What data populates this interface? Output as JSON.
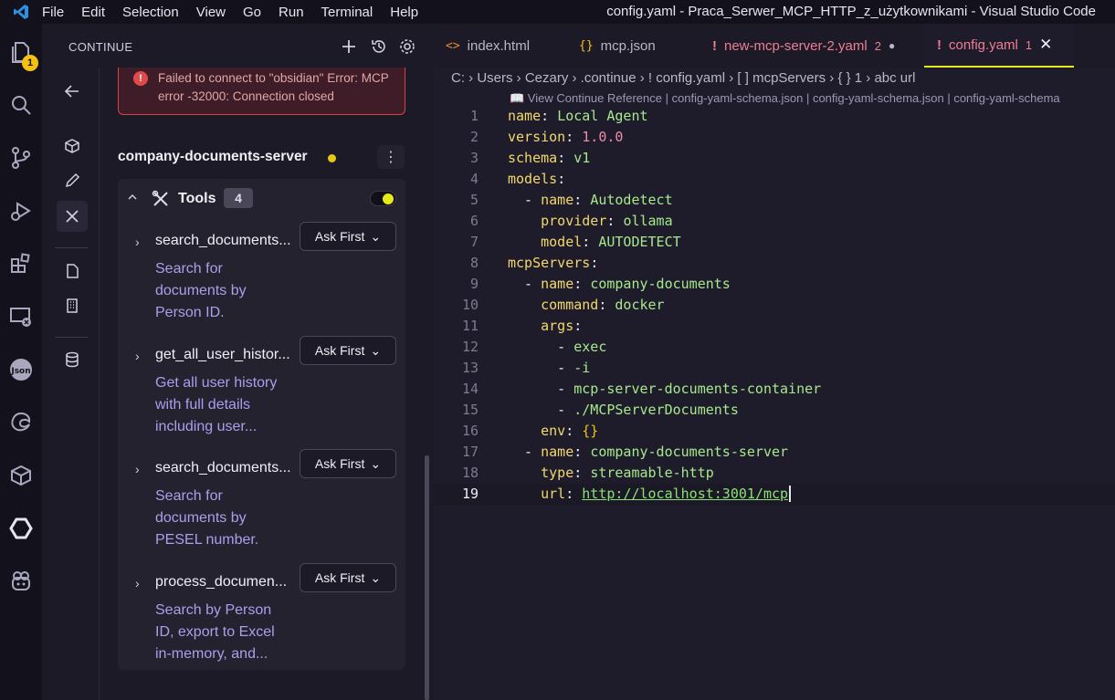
{
  "titlebar": {
    "menu": [
      "File",
      "Edit",
      "Selection",
      "View",
      "Go",
      "Run",
      "Terminal",
      "Help"
    ],
    "title": "config.yaml - Praca_Serwer_MCP_HTTP_z_użytkownikami - Visual Studio Code"
  },
  "activity": {
    "badge": "1"
  },
  "panel": {
    "title": "CONTINUE",
    "error": {
      "text": "Failed to connect to \"obsidian\" Error: MCP error -32000: Connection closed"
    },
    "server": {
      "name": "company-documents-server"
    },
    "tools": {
      "label": "Tools",
      "count": "4",
      "items": [
        {
          "name": "search_documents...",
          "desc": "Search for documents by Person ID.",
          "ask": "Ask First"
        },
        {
          "name": "get_all_user_histor...",
          "desc": "Get all user history with full details including user...",
          "ask": "Ask First"
        },
        {
          "name": "search_documents...",
          "desc": "Search for documents by PESEL number.",
          "ask": "Ask First"
        },
        {
          "name": "process_documen...",
          "desc": "Search by Person ID, export to Excel in-memory, and...",
          "ask": "Ask First"
        }
      ]
    }
  },
  "tabs": [
    {
      "label": "index.html",
      "icon": "<>"
    },
    {
      "label": "mcp.json",
      "icon": "{}"
    },
    {
      "label": "new-mcp-server-2.yaml",
      "badge": "2",
      "icon": "!"
    },
    {
      "label": "config.yaml",
      "badge": "1",
      "icon": "!"
    }
  ],
  "breadcrumb": {
    "text": "C: › Users › Cezary › .continue › ! config.yaml › [ ] mcpServers › { } 1 › abc url"
  },
  "schema_ref": "📖 View Continue Reference | config-yaml-schema.json | config-yaml-schema.json | config-yaml-schema",
  "code": [
    {
      "n": "1",
      "k": "name",
      "v": "Local Agent",
      "vc": "v",
      "ind": ""
    },
    {
      "n": "2",
      "k": "version",
      "v": "1.0.0",
      "vc": "n",
      "ind": ""
    },
    {
      "n": "3",
      "k": "schema",
      "v": "v1",
      "vc": "v",
      "ind": ""
    },
    {
      "n": "4",
      "k": "models",
      "v": "",
      "vc": "v",
      "ind": ""
    },
    {
      "n": "5",
      "k": "name",
      "v": "Autodetect",
      "vc": "v",
      "ind": "  - "
    },
    {
      "n": "6",
      "k": "provider",
      "v": "ollama",
      "vc": "v",
      "ind": "    "
    },
    {
      "n": "7",
      "k": "model",
      "v": "AUTODETECT",
      "vc": "v",
      "ind": "    "
    },
    {
      "n": "8",
      "k": "mcpServers",
      "v": "",
      "vc": "v",
      "ind": ""
    },
    {
      "n": "9",
      "k": "name",
      "v": "company-documents",
      "vc": "v",
      "ind": "  - "
    },
    {
      "n": "10",
      "k": "command",
      "v": "docker",
      "vc": "v",
      "ind": "    "
    },
    {
      "n": "11",
      "k": "args",
      "v": "",
      "vc": "v",
      "ind": "    "
    },
    {
      "n": "12",
      "k": "",
      "v": "exec",
      "vc": "v",
      "ind": "      - "
    },
    {
      "n": "13",
      "k": "",
      "v": "-i",
      "vc": "v",
      "ind": "      - "
    },
    {
      "n": "14",
      "k": "",
      "v": "mcp-server-documents-container",
      "vc": "v",
      "ind": "      - "
    },
    {
      "n": "15",
      "k": "",
      "v": "./MCPServerDocuments",
      "vc": "v",
      "ind": "      - "
    },
    {
      "n": "16",
      "k": "env",
      "v": "{}",
      "vc": "b",
      "ind": "    "
    },
    {
      "n": "17",
      "k": "name",
      "v": "company-documents-server",
      "vc": "v",
      "ind": "  - "
    },
    {
      "n": "18",
      "k": "type",
      "v": "streamable-http",
      "vc": "v",
      "ind": "    "
    },
    {
      "n": "19",
      "k": "url",
      "v": "http://localhost:3001/mcp",
      "vc": "u",
      "ind": "    "
    }
  ]
}
